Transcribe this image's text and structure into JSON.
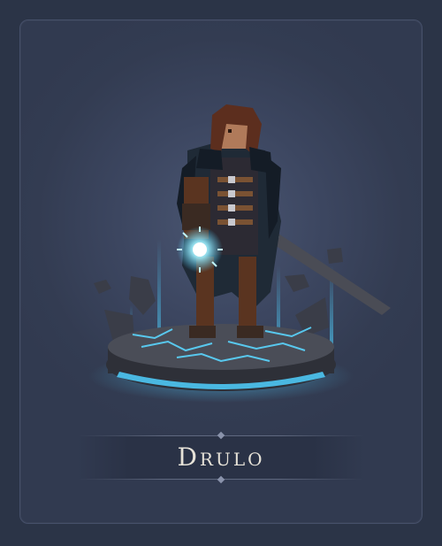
{
  "character": {
    "name": "Drulo"
  },
  "colors": {
    "background": "#2b3447",
    "card": "#3c4660",
    "glow": "#4fd0ff",
    "banner": "#2a3246",
    "name_text": "#e6e2d8"
  },
  "icons": [
    "character-sprite",
    "magic-orb-icon",
    "sword-icon",
    "stone-platform"
  ]
}
